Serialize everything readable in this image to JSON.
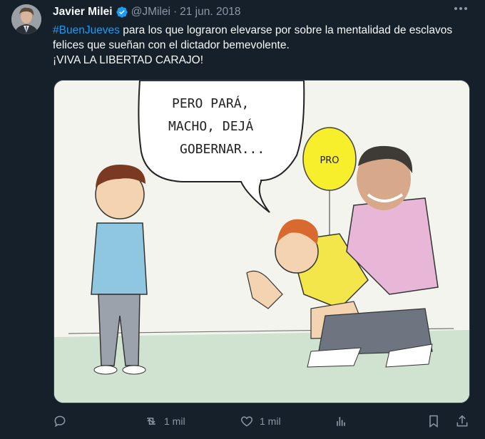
{
  "tweet": {
    "author_name": "Javier Milei",
    "handle": "@JMilei",
    "separator": "·",
    "date": "21 jun. 2018",
    "hashtag": "#BuenJueves",
    "text_after_hashtag": " para los que lograron elevarse por sobre la mentalidad de esclavos felices que sueñan con el dictador bemevolente.",
    "text_line2": "¡VIVA LA LIBERTAD CARAJO!"
  },
  "media": {
    "speech_bubble_lines": [
      "PERO PARÁ,",
      "MACHO, DEJÁ",
      "GOBERNAR..."
    ],
    "balloon_label": "PRO"
  },
  "actions": {
    "reply_count": "",
    "retweet_count": "1 mil",
    "like_count": "1 mil",
    "views_count": ""
  },
  "icons": [
    "verified-badge-icon",
    "more-icon",
    "reply-icon",
    "retweet-icon",
    "like-icon",
    "views-icon",
    "bookmark-icon",
    "share-icon"
  ],
  "colors": {
    "background": "#15202b",
    "accent": "#1d9bf0",
    "muted": "#8b98a5",
    "text": "#f7f9f9"
  }
}
